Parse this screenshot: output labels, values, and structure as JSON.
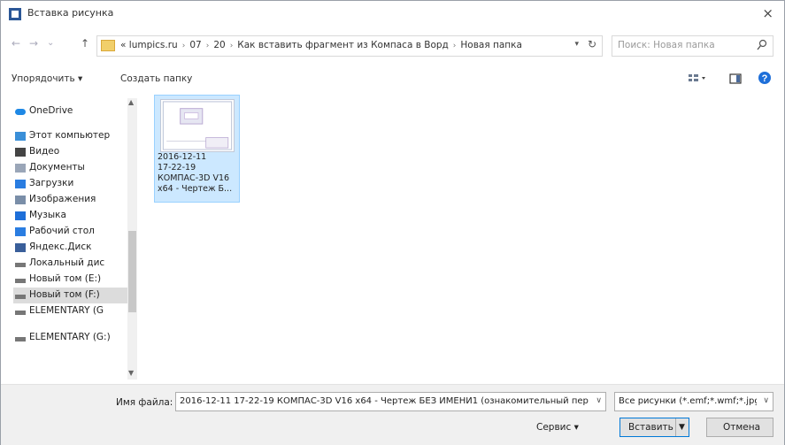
{
  "window": {
    "title": "Вставка рисунка",
    "close_glyph": "×"
  },
  "nav": {
    "back_glyph": "←",
    "forward_glyph": "→",
    "recent_glyph": "⌄",
    "up_glyph": "↑",
    "breadcrumb": [
      "«",
      "lumpics.ru",
      "07",
      "20",
      "Как вставить фрагмент из Компаса в Ворд",
      "Новая папка"
    ],
    "search_placeholder": "Поиск: Новая папка"
  },
  "toolbar": {
    "organize": "Упорядочить ▾",
    "new_folder": "Создать папку"
  },
  "sidebar": {
    "items": [
      {
        "label": "OneDrive",
        "icon": "cloud-icon",
        "selected": false
      },
      {
        "label": "Этот компьютер",
        "icon": "computer-icon",
        "selected": false
      },
      {
        "label": "Видео",
        "icon": "video-icon",
        "selected": false
      },
      {
        "label": "Документы",
        "icon": "document-icon",
        "selected": false
      },
      {
        "label": "Загрузки",
        "icon": "download-icon",
        "selected": false
      },
      {
        "label": "Изображения",
        "icon": "image-icon",
        "selected": false
      },
      {
        "label": "Музыка",
        "icon": "music-icon",
        "selected": false
      },
      {
        "label": "Рабочий стол",
        "icon": "desktop-icon",
        "selected": false
      },
      {
        "label": "Яндекс.Диск",
        "icon": "yandex-disk-icon",
        "selected": false
      },
      {
        "label": "Локальный дис",
        "icon": "drive-icon",
        "selected": false
      },
      {
        "label": "Новый том (E:)",
        "icon": "drive-icon",
        "selected": false
      },
      {
        "label": "Новый том (F:)",
        "icon": "drive-icon",
        "selected": true
      },
      {
        "label": "ELEMENTARY (G",
        "icon": "drive-icon",
        "selected": false
      },
      {
        "label": "ELEMENTARY (G:)",
        "icon": "drive-icon",
        "selected": false
      }
    ]
  },
  "files": [
    {
      "name_lines": [
        "2016-12-11",
        "17-22-19",
        "КОМПАС-3D V16",
        "x64 - Чертеж Б..."
      ]
    }
  ],
  "bottom": {
    "filename_label": "Имя файла:",
    "filename_value": "2016-12-11 17-22-19 КОМПАС-3D V16 x64 - Чертеж БЕЗ ИМЕНИ1 (ознакомительный период",
    "filetype_value": "Все рисунки (*.emf;*.wmf;*.jpg",
    "service": "Сервис ▾",
    "insert": "Вставить",
    "cancel": "Отмена"
  },
  "colors": {
    "selection": "#cce8ff",
    "selection_border": "#99d1ff",
    "accent": "#0078d7",
    "help": "#1e6fd9"
  }
}
